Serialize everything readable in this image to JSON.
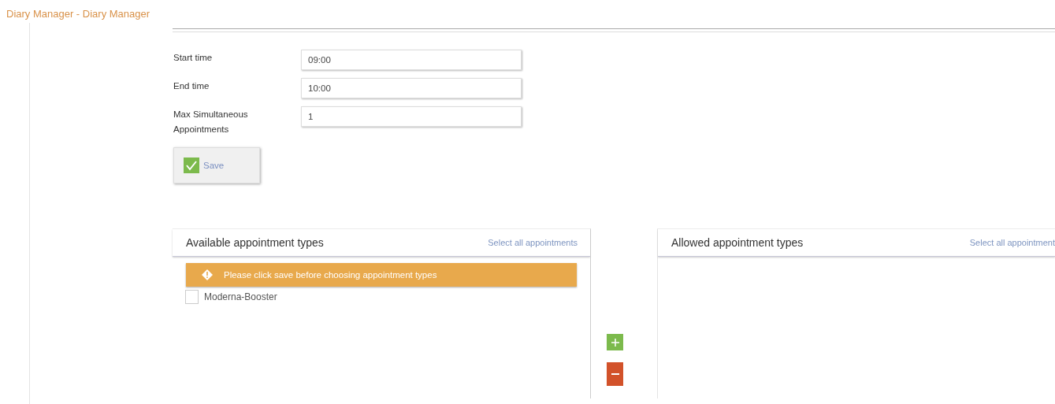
{
  "window": {
    "title": "Diary Manager - Diary Manager"
  },
  "form": {
    "fields": [
      {
        "label": "Start time",
        "value": "09:00"
      },
      {
        "label": "End time",
        "value": "10:00"
      },
      {
        "label": "Max Simultaneous Appointments",
        "value": "1"
      }
    ],
    "save_button": {
      "label": "Save"
    }
  },
  "available_panel": {
    "title": "Available appointment types",
    "select_all": "Select all appointments",
    "warning": "Please click save before choosing appointment types",
    "items": [
      {
        "label": "Moderna-Booster",
        "checked": false
      }
    ]
  },
  "allowed_panel": {
    "title": "Allowed appointment types",
    "select_all": "Select all appointment"
  }
}
